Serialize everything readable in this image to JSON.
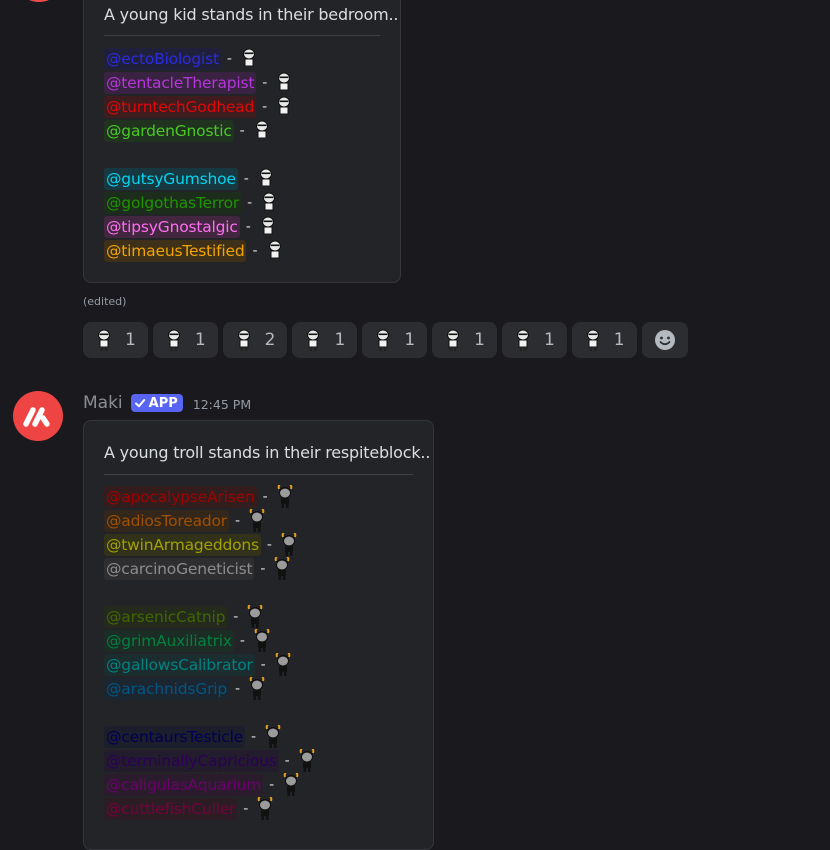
{
  "message1": {
    "embed_title": "A young kid stands in their bedroom..",
    "groups": [
      [
        {
          "name": "@ectoBiologist",
          "color": "#2b2be0",
          "bg": "#20203a"
        },
        {
          "name": "@tentacleTherapist",
          "color": "#b536da",
          "bg": "#3a2242"
        },
        {
          "name": "@turntechGodhead",
          "color": "#e00707",
          "bg": "#3f1c1e"
        },
        {
          "name": "@gardenGnostic",
          "color": "#4ac925",
          "bg": "#20331f"
        }
      ],
      [
        {
          "name": "@gutsyGumshoe",
          "color": "#00d5f2",
          "bg": "#173840"
        },
        {
          "name": "@golgothasTerror",
          "color": "#1f9400",
          "bg": "#1d2d1c"
        },
        {
          "name": "@tipsyGnostalgic",
          "color": "#ff6ff2",
          "bg": "#43263f"
        },
        {
          "name": "@timaeusTestified",
          "color": "#f2a400",
          "bg": "#3f3019"
        }
      ]
    ],
    "edited_label": "(edited)",
    "reactions": [
      {
        "icon": "kid-sprite-icon",
        "count": "1"
      },
      {
        "icon": "kid-sprite-icon",
        "count": "1"
      },
      {
        "icon": "kid-sprite-icon",
        "count": "2"
      },
      {
        "icon": "kid-sprite-icon",
        "count": "1"
      },
      {
        "icon": "kid-sprite-icon",
        "count": "1"
      },
      {
        "icon": "kid-sprite-icon",
        "count": "1"
      },
      {
        "icon": "kid-sprite-icon",
        "count": "1"
      },
      {
        "icon": "kid-sprite-icon",
        "count": "1"
      }
    ]
  },
  "message2": {
    "author": "Maki",
    "badge": "APP",
    "timestamp": "12:45 PM",
    "embed_title": "A young troll stands in their respiteblock..",
    "groups": [
      [
        {
          "name": "@apocalypseArisen",
          "color": "#a10000",
          "bg": "#331d1d"
        },
        {
          "name": "@adiosToreador",
          "color": "#a15000",
          "bg": "#33261a"
        },
        {
          "name": "@twinArmageddons",
          "color": "#a1a100",
          "bg": "#32321b"
        },
        {
          "name": "@carcinoGeneticist",
          "color": "#8c8c8c",
          "bg": "#2e2e30"
        }
      ],
      [
        {
          "name": "@arsenicCatnip",
          "color": "#416600",
          "bg": "#242b1d"
        },
        {
          "name": "@grimAuxiliatrix",
          "color": "#008141",
          "bg": "#1b2d24"
        },
        {
          "name": "@gallowsCalibrator",
          "color": "#008282",
          "bg": "#1b2d2e"
        },
        {
          "name": "@arachnidsGrip",
          "color": "#005682",
          "bg": "#1b2631"
        }
      ],
      [
        {
          "name": "@centaursTesticle",
          "color": "#000056",
          "bg": "#1d1e2c"
        },
        {
          "name": "@terminallyCapricious",
          "color": "#2b0057",
          "bg": "#221c2c"
        },
        {
          "name": "@caligulasAquarium",
          "color": "#6a006a",
          "bg": "#2a1c2c"
        },
        {
          "name": "@cuttlefishCuller",
          "color": "#77003c",
          "bg": "#2c1c24"
        }
      ]
    ]
  }
}
